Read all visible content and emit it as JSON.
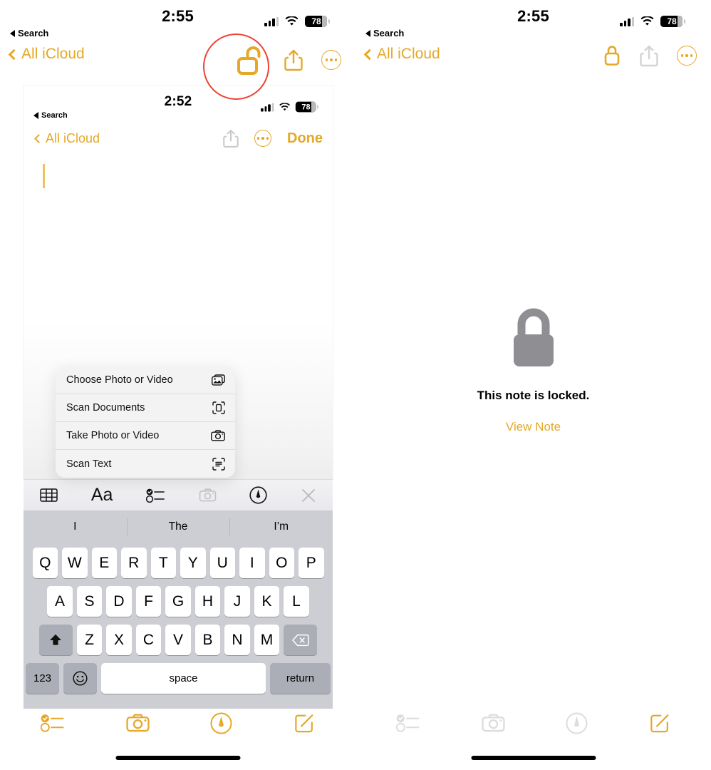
{
  "accent_color": "#E5A827",
  "annotation_color": "#EE4235",
  "left_panel": {
    "status_bar": {
      "time": "2:55",
      "back_label": "Search",
      "battery": "78"
    },
    "nav": {
      "back_label": "All iCloud",
      "lock_icon": "unlock-open-icon",
      "share_icon": "share-icon",
      "more_icon": "more-ellipsis-icon"
    },
    "annotation": {
      "shape": "circle",
      "target": "unlock-open-icon"
    },
    "bottom_toolbar": [
      {
        "name": "checklist-icon",
        "state": "active"
      },
      {
        "name": "camera-icon",
        "state": "active"
      },
      {
        "name": "markup-pen-icon",
        "state": "active"
      },
      {
        "name": "compose-icon",
        "state": "active"
      }
    ]
  },
  "nested_screenshot": {
    "status_bar": {
      "time": "2:52",
      "back_label": "Search",
      "battery": "78"
    },
    "nav": {
      "back_label": "All iCloud",
      "share_icon": "share-icon",
      "more_icon": "more-ellipsis-icon",
      "done_label": "Done"
    },
    "note_body": {
      "text": "",
      "caret_visible": true
    },
    "context_menu": [
      {
        "label": "Choose Photo or Video",
        "icon": "photos-icon"
      },
      {
        "label": "Scan Documents",
        "icon": "scan-document-icon"
      },
      {
        "label": "Take Photo or Video",
        "icon": "camera-icon"
      },
      {
        "label": "Scan Text",
        "icon": "scan-text-icon"
      }
    ],
    "keyboard_toolbar": [
      {
        "name": "table-icon",
        "state": "active"
      },
      {
        "name": "text-format-icon",
        "label": "Aa",
        "state": "active"
      },
      {
        "name": "checklist-icon",
        "state": "active"
      },
      {
        "name": "camera-icon",
        "state": "disabled"
      },
      {
        "name": "markup-pen-icon",
        "state": "active"
      },
      {
        "name": "close-icon",
        "state": "active"
      }
    ],
    "predictive_text": [
      "I",
      "The",
      "I’m"
    ],
    "keyboard": {
      "row1": [
        "Q",
        "W",
        "E",
        "R",
        "T",
        "Y",
        "U",
        "I",
        "O",
        "P"
      ],
      "row2": [
        "A",
        "S",
        "D",
        "F",
        "G",
        "H",
        "J",
        "K",
        "L"
      ],
      "row3": [
        "Z",
        "X",
        "C",
        "V",
        "B",
        "N",
        "M"
      ],
      "shift_icon": "shift-icon",
      "backspace_icon": "backspace-icon",
      "numbers_label": "123",
      "emoji_icon": "emoji-icon",
      "space_label": "space",
      "return_label": "return"
    }
  },
  "right_panel": {
    "status_bar": {
      "time": "2:55",
      "back_label": "Search",
      "battery": "78"
    },
    "nav": {
      "back_label": "All iCloud",
      "lock_icon": "lock-closed-icon",
      "share_icon": "share-icon",
      "more_icon": "more-ellipsis-icon"
    },
    "locked_note": {
      "icon": "lock-closed-large-icon",
      "message": "This note is locked.",
      "action_label": "View Note"
    },
    "bottom_toolbar": [
      {
        "name": "checklist-icon",
        "state": "disabled"
      },
      {
        "name": "camera-icon",
        "state": "disabled"
      },
      {
        "name": "markup-pen-icon",
        "state": "disabled"
      },
      {
        "name": "compose-icon",
        "state": "active"
      }
    ]
  }
}
